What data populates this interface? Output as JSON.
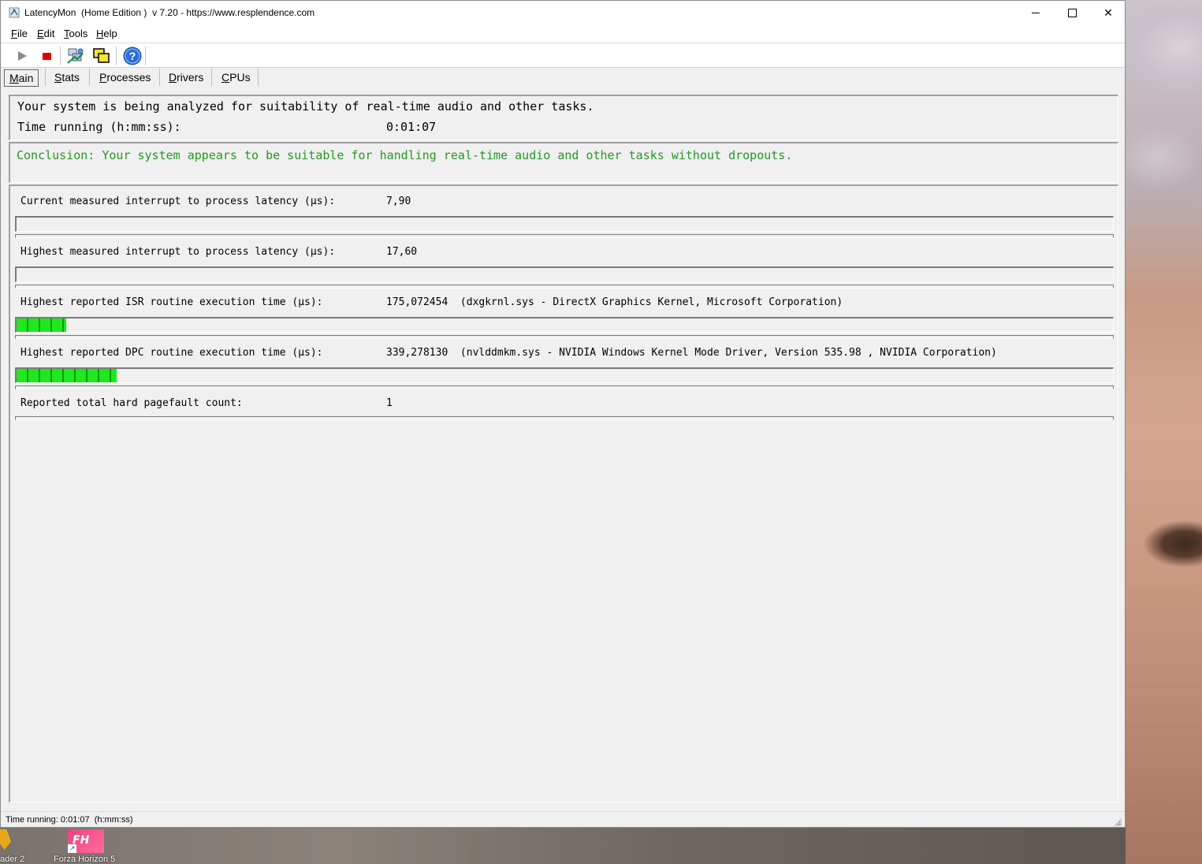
{
  "window": {
    "title": "LatencyMon  (Home Edition )  v 7.20 - https://www.resplendence.com",
    "minimize_glyph": "",
    "close_glyph": "✕"
  },
  "menu": {
    "file": {
      "u": "F",
      "rest": "ile"
    },
    "edit": {
      "u": "E",
      "rest": "dit"
    },
    "tools": {
      "u": "T",
      "rest": "ools"
    },
    "help": {
      "u": "H",
      "rest": "elp"
    }
  },
  "toolbar": {
    "icons": [
      "play-icon",
      "stop-icon",
      "drivers-icon",
      "windows-icon",
      "help-icon"
    ],
    "help_glyph": "?"
  },
  "tabs": {
    "main": {
      "u": "M",
      "rest": "ain"
    },
    "stats": {
      "u": "S",
      "rest": "tats"
    },
    "processes": {
      "u": "P",
      "rest": "rocesses"
    },
    "drivers": {
      "u": "D",
      "rest": "rivers"
    },
    "cpus": {
      "u": "C",
      "rest": "PUs"
    }
  },
  "status": {
    "line": "Your system is being analyzed for suitability of real-time audio and other tasks.",
    "time_label": "Time running (h:mm:ss):",
    "time_value": "0:01:07"
  },
  "conclusion": {
    "text": "Conclusion: Your system appears to be suitable for handling real-time audio and other tasks without dropouts.",
    "color": "#229a22"
  },
  "metrics": [
    {
      "label": "Current measured interrupt to process latency (µs):",
      "value": "7,90",
      "bar_fraction": 0
    },
    {
      "label": "Highest measured interrupt to process latency (µs):",
      "value": "17,60",
      "bar_fraction": 0
    },
    {
      "label": "Highest reported ISR routine execution time (µs):",
      "value": "175,072454  (dxgkrnl.sys - DirectX Graphics Kernel, Microsoft Corporation)",
      "bar_fraction": 0.045
    },
    {
      "label": "Highest reported DPC routine execution time (µs):",
      "value": "339,278130  (nvlddmkm.sys - NVIDIA Windows Kernel Mode Driver, Version 535.98 , NVIDIA Corporation)",
      "bar_fraction": 0.091
    },
    {
      "label": "Reported total hard pagefault count:",
      "value": "1"
    }
  ],
  "statusbar": {
    "text": "Time running: 0:01:07  (h:mm:ss)"
  },
  "desktop": {
    "icons": [
      {
        "label": "ader 2"
      },
      {
        "label": "Forza Horizon 5",
        "glyph": "FH",
        "shortcut_glyph": "↗"
      }
    ]
  },
  "colors": {
    "bar_green": "#1ee81e",
    "bar_dark_green": "#0a9a0a",
    "stop_red": "#e00000",
    "help_blue": "#2a6fd6"
  }
}
